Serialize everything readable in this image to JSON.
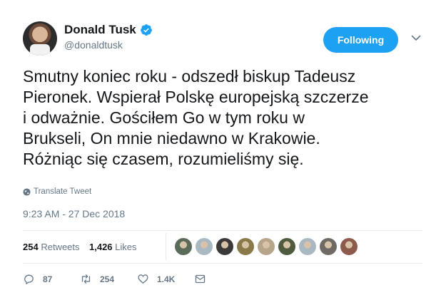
{
  "author": {
    "name": "Donald Tusk",
    "handle": "@donaldtusk",
    "verified": true,
    "avatar_icon": "avatar-portrait"
  },
  "follow_button": {
    "label": "Following",
    "color": "#1da1f2"
  },
  "menu_icon": "chevron-down-icon",
  "tweet": {
    "text": "Smutny koniec roku - odszedł biskup Tadeusz\nPieronek. Wspierał Polskę europejską szczerze\ni odważnie. Gościłem Go w tym roku w\nBrukseli, On mnie niedawno w Krakowie.\nRóżniąc się czasem, rozumieliśmy się.",
    "translate_label": "Translate Tweet",
    "timestamp": "9:23 AM - 27 Dec 2018"
  },
  "stats": {
    "retweets_count": "254",
    "retweets_label": "Retweets",
    "likes_count": "1,426",
    "likes_label": "Likes",
    "likers": [
      {
        "color": "#5b6b5a"
      },
      {
        "color": "#aab8c2"
      },
      {
        "color": "#3c3a38"
      },
      {
        "color": "#8a7a4a"
      },
      {
        "color": "#b6a58a"
      },
      {
        "color": "#4e5b3e"
      },
      {
        "color": "#aab8c2"
      },
      {
        "color": "#6f6a64"
      },
      {
        "color": "#8e5a4c"
      }
    ]
  },
  "actions": {
    "reply_count": "87",
    "retweet_count": "254",
    "like_count": "1.4K"
  },
  "colors": {
    "text": "#14171a",
    "secondary": "#657786",
    "accent": "#1da1f2",
    "divider": "#e6ecf0"
  }
}
